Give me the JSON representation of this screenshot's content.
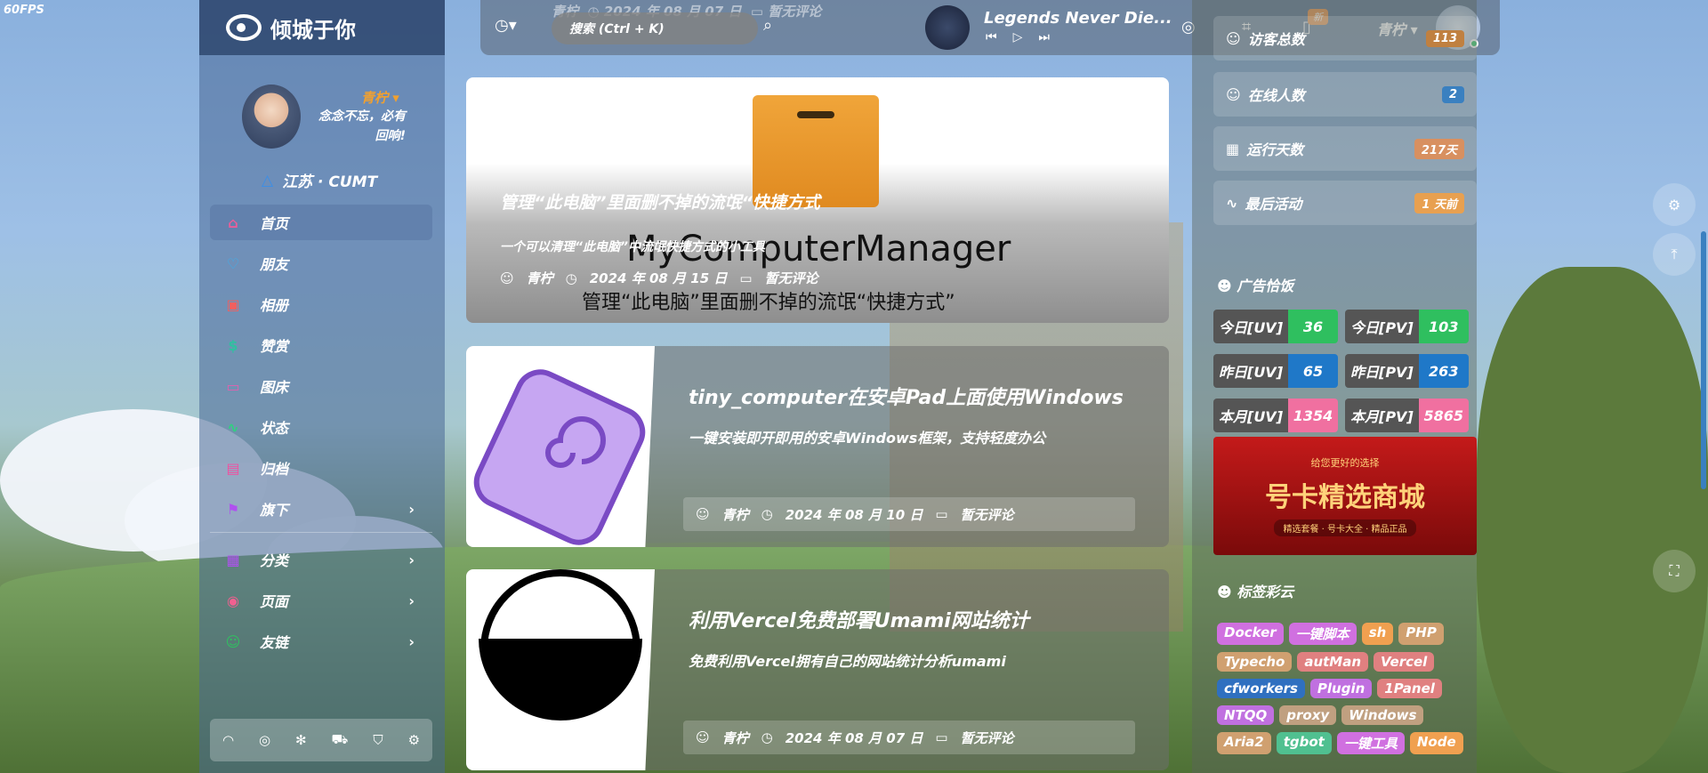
{
  "fps": "60FPS",
  "brand": "倾城于你",
  "profile": {
    "name": "青柠",
    "motto": "念念不忘，必有回响!",
    "location": "江苏 · CUMT"
  },
  "nav": [
    {
      "label": "首页",
      "icon": "home-icon",
      "color": "#e95e9a"
    },
    {
      "label": "朋友",
      "icon": "heart-icon",
      "color": "#3ab0f0"
    },
    {
      "label": "相册",
      "icon": "image-icon",
      "color": "#f06060"
    },
    {
      "label": "赞赏",
      "icon": "dollar-icon",
      "color": "#30c0a0"
    },
    {
      "label": "图床",
      "icon": "folder-icon",
      "color": "#e060b0"
    },
    {
      "label": "状态",
      "icon": "activity-icon",
      "color": "#30d080"
    },
    {
      "label": "归档",
      "icon": "archive-icon",
      "color": "#f050a0"
    },
    {
      "label": "旗下",
      "icon": "flag-icon",
      "color": "#b050f0"
    },
    {
      "label": "分类",
      "icon": "grid-icon",
      "color": "#b050f0"
    },
    {
      "label": "页面",
      "icon": "page-icon",
      "color": "#f06090"
    },
    {
      "label": "友链",
      "icon": "person-icon",
      "color": "#30c060"
    }
  ],
  "footer_icons": [
    "rss-icon",
    "github-icon",
    "gear-flower-icon",
    "truck-icon",
    "cart-icon",
    "settings-icon"
  ],
  "topbar": {
    "search_placeholder": "搜索 (Ctrl + K)",
    "song": "Legends Never Die...",
    "badge": "新",
    "user": "青柠"
  },
  "featured": {
    "title": "管理“此电脑”里面删不掉的流氓“快捷方式",
    "desc": "一个可以清理“此电脑”中流氓快捷方式的小工具",
    "big": "MyComputerManager",
    "caption": "管理“此电脑”里面删不掉的流氓“快捷方式”",
    "author": "青柠",
    "date": "2024 年 08 月 15 日",
    "comments": "暂无评论"
  },
  "posts": [
    {
      "title": "tiny_computer在安卓Pad上面使用Windows",
      "desc": "一键安装即开即用的安卓Windows框架，支持轻度办公",
      "author": "青柠",
      "date": "2024 年 08 月 10 日",
      "comments": "暂无评论"
    },
    {
      "title": "利用Vercel免费部署Umami网站统计",
      "desc": "免费利用Vercel拥有自己的网站统计分析umami",
      "author": "青柠",
      "date": "2024 年 08 月 07 日",
      "comments": "暂无评论"
    }
  ],
  "top_meta": {
    "author": "青柠",
    "date": "2024 年 08 月 07 日",
    "comments": "暂无评论"
  },
  "stats": [
    {
      "label": "访客总数",
      "value": "113",
      "color": "#c08040"
    },
    {
      "label": "在线人数",
      "value": "2",
      "color": "#3a80c0"
    },
    {
      "label": "运行天数",
      "value": "217天",
      "color": "#d89060"
    },
    {
      "label": "最后活动",
      "value": "1 天前",
      "color": "#e8a050"
    }
  ],
  "ads_title": "广告恰饭",
  "uvpv": [
    {
      "k": "今日[UV]",
      "v": "36",
      "color": "#2fbf5f"
    },
    {
      "k": "今日[PV]",
      "v": "103",
      "color": "#2fbf5f"
    },
    {
      "k": "昨日[UV]",
      "v": "65",
      "color": "#1f78c8"
    },
    {
      "k": "昨日[PV]",
      "v": "263",
      "color": "#1f78c8"
    },
    {
      "k": "本月[UV]",
      "v": "1354",
      "color": "#f070a0"
    },
    {
      "k": "本月[PV]",
      "v": "5865",
      "color": "#f070a0"
    }
  ],
  "ad": {
    "sub": "给您更好的选择",
    "main": "号卡精选商城",
    "foot": "精选套餐 · 号卡大全 · 精品正品"
  },
  "tags_title": "标签彩云",
  "tags": [
    {
      "t": "Docker",
      "c": "#d070e0"
    },
    {
      "t": "一键脚本",
      "c": "#d070e0"
    },
    {
      "t": "sh",
      "c": "#f0a050"
    },
    {
      "t": "PHP",
      "c": "#d0a070"
    },
    {
      "t": "Typecho",
      "c": "#d0a070"
    },
    {
      "t": "autMan",
      "c": "#e08080"
    },
    {
      "t": "Vercel",
      "c": "#e08080"
    },
    {
      "t": "cfworkers",
      "c": "#2f70c0"
    },
    {
      "t": "Plugin",
      "c": "#c070e0"
    },
    {
      "t": "1Panel",
      "c": "#e08080"
    },
    {
      "t": "NTQQ",
      "c": "#c070e0"
    },
    {
      "t": "proxy",
      "c": "#c0a080"
    },
    {
      "t": "Windows",
      "c": "#c0a080"
    },
    {
      "t": "Aria2",
      "c": "#d0a070"
    },
    {
      "t": "tgbot",
      "c": "#50c090"
    },
    {
      "t": "一键工具",
      "c": "#d070e0"
    },
    {
      "t": "Node",
      "c": "#f0a050"
    }
  ]
}
